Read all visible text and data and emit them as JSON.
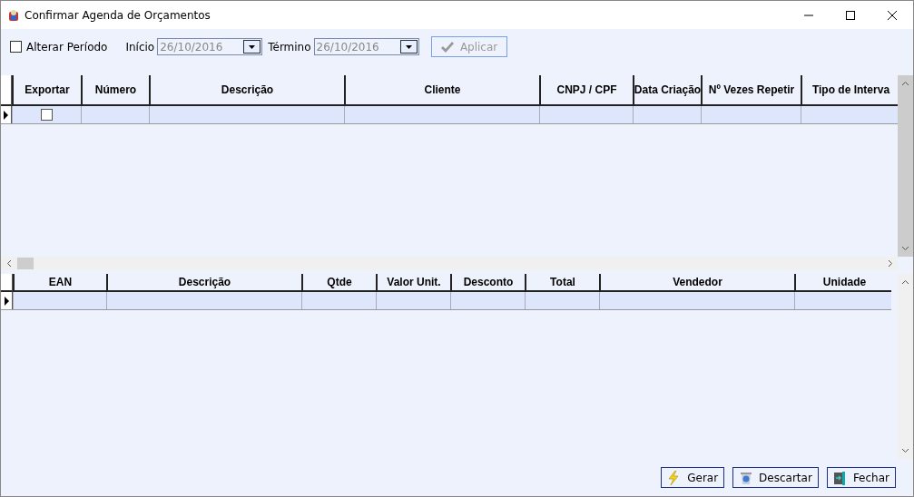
{
  "window": {
    "title": "Confirmar Agenda de Orçamentos"
  },
  "filter": {
    "alter_period": {
      "label": "Alterar Período",
      "checked": false
    },
    "start": {
      "label": "Início",
      "value": "26/10/2016",
      "disabled": true
    },
    "end": {
      "label": "Término",
      "value": "26/10/2016",
      "disabled": true
    },
    "apply_button": {
      "label": "Aplicar",
      "disabled": true
    }
  },
  "schedule_table": {
    "columns": [
      "Exportar",
      "Número",
      "Descrição",
      "Cliente",
      "CNPJ / CPF",
      "Data Criação",
      "Nº Vezes Repetir",
      "Tipo de Interva"
    ],
    "rows": [
      {
        "current": true,
        "export_checked": false
      }
    ]
  },
  "items_table": {
    "columns": [
      "EAN",
      "Descrição",
      "Qtde",
      "Valor Unit.",
      "Desconto",
      "Total",
      "Vendedor",
      "Unidade"
    ],
    "rows": [
      {
        "current": true
      }
    ]
  },
  "buttons": [
    {
      "kind": "generate",
      "label": "Gerar"
    },
    {
      "kind": "discard",
      "label": "Descartar"
    },
    {
      "kind": "close",
      "label": "Fechar"
    }
  ]
}
